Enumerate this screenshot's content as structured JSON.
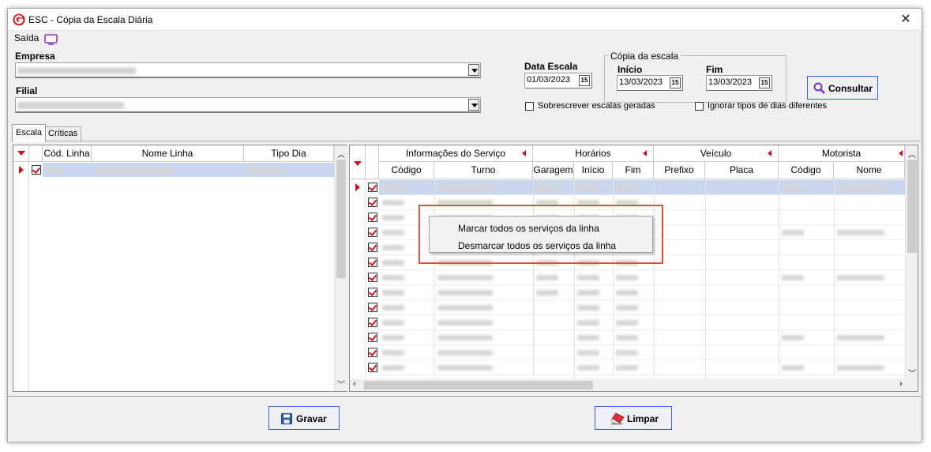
{
  "window": {
    "title": "ESC - Cópia da Escala Diária",
    "close_glyph": "✕"
  },
  "menu": {
    "saida": "Saída"
  },
  "filters": {
    "empresa_label": "Empresa",
    "filial_label": "Filial",
    "data_escala_label": "Data Escala",
    "data_escala_value": "01/03/2023",
    "copia_group_title": "Cópia da escala",
    "inicio_label": "Início",
    "inicio_value": "13/03/2023",
    "fim_label": "Fim",
    "fim_value": "13/03/2023",
    "calendar_glyph": "15",
    "sobrescrever_label": "Sobrescrever escalas geradas",
    "ignorar_label": "Ignorar tipos de dias diferentes",
    "consultar_label": "Consultar"
  },
  "tabs": [
    {
      "label": "Escala"
    },
    {
      "label": "Críticas"
    }
  ],
  "left_grid": {
    "columns": [
      "Cód. Linha",
      "Nome Linha",
      "Tipo Dia"
    ]
  },
  "right_grid": {
    "groups": [
      "Informações do Serviço",
      "Horários",
      "Veículo",
      "Motorista"
    ],
    "columns": [
      "Código",
      "Turno",
      "Garagem",
      "Início",
      "Fim",
      "Prefixo",
      "Placa",
      "Código",
      "Nome"
    ],
    "row_count": 13
  },
  "context_menu": {
    "items": [
      "Marcar todos os serviços da linha",
      "Desmarcar todos os serviços da linha"
    ]
  },
  "buttons": {
    "gravar": "Gravar",
    "limpar": "Limpar"
  },
  "colors": {
    "accent_red": "#d0101a",
    "selection": "#c9d6ee",
    "highlight_border": "#d05a3a"
  },
  "icons": [
    "app-logo-icon",
    "monitor-icon",
    "search-icon",
    "save-icon",
    "eraser-icon",
    "calendar-icon",
    "close-icon"
  ]
}
